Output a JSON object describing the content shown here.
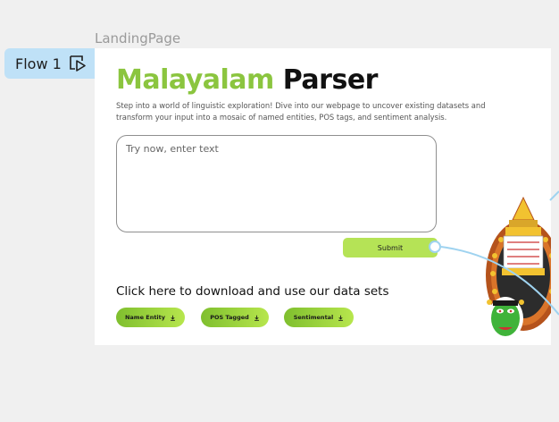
{
  "canvas": {
    "frame_label": "LandingPage",
    "flow_label": "Flow 1",
    "flow_icon": "play-frame-icon"
  },
  "header": {
    "title_accent": "Malayalam",
    "title_main": "Parser",
    "description": "Step into a world of linguistic exploration! Dive into our webpage to uncover existing datasets and transform your input into a mosaic of named entities, POS tags, and sentiment analysis."
  },
  "input": {
    "placeholder": "Try now, enter text"
  },
  "actions": {
    "submit_label": "Submit"
  },
  "downloads": {
    "heading": "Click here to download and use our data sets",
    "buttons": [
      {
        "label": "Name Entity",
        "icon": "download-icon"
      },
      {
        "label": "POS Tagged",
        "icon": "download-icon"
      },
      {
        "label": "Sentimental",
        "icon": "download-icon"
      }
    ]
  },
  "colors": {
    "accent_green": "#8bc53f",
    "button_green": "#b5e356",
    "flow_badge": "#bfe1f7",
    "connector": "#9fd3f0"
  },
  "illustration": "kathakali-dancer"
}
